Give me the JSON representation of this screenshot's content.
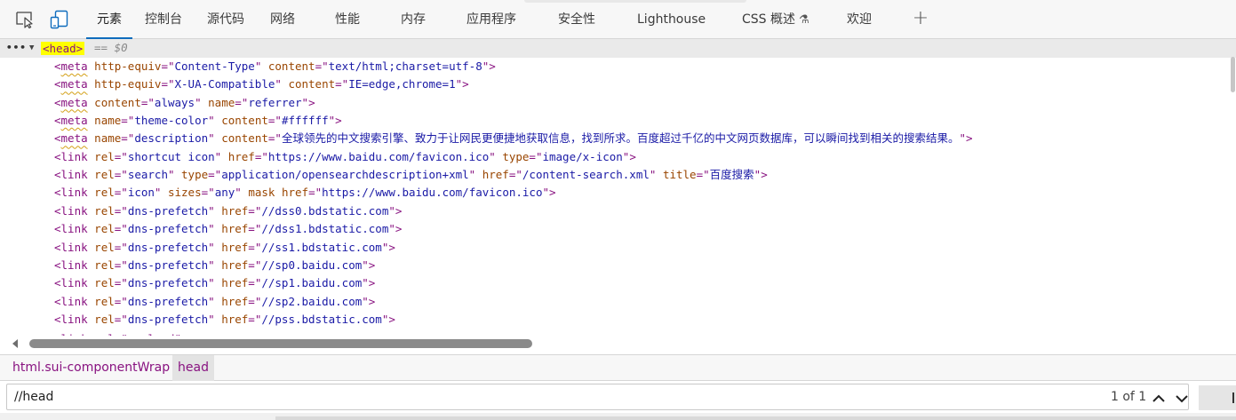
{
  "tabs": [
    {
      "label": "元素",
      "active": true
    },
    {
      "label": "控制台"
    },
    {
      "label": "源代码"
    },
    {
      "label": "网络"
    },
    {
      "label": "性能"
    },
    {
      "label": "内存"
    },
    {
      "label": "应用程序"
    },
    {
      "label": "安全性"
    },
    {
      "label": "Lighthouse"
    },
    {
      "label": "CSS 概述"
    },
    {
      "label": "欢迎"
    }
  ],
  "add_tab_label": "+",
  "dom": {
    "dots": "•••",
    "head_tag": "<head>",
    "selected_marker": "== $0",
    "lines": [
      {
        "tag": "meta",
        "attrs": [
          [
            "http-equiv",
            "Content-Type"
          ],
          [
            "content",
            "text/html;charset=utf-8"
          ]
        ]
      },
      {
        "tag": "meta",
        "attrs": [
          [
            "http-equiv",
            "X-UA-Compatible"
          ],
          [
            "content",
            "IE=edge,chrome=1"
          ]
        ]
      },
      {
        "tag": "meta",
        "attrs": [
          [
            "content",
            "always"
          ],
          [
            "name",
            "referrer"
          ]
        ]
      },
      {
        "tag": "meta",
        "attrs": [
          [
            "name",
            "theme-color"
          ],
          [
            "content",
            "#ffffff"
          ]
        ]
      },
      {
        "tag": "meta",
        "attrs": [
          [
            "name",
            "description"
          ],
          [
            "content",
            "全球领先的中文搜索引擎、致力于让网民更便捷地获取信息，找到所求。百度超过千亿的中文网页数据库，可以瞬间找到相关的搜索结果。"
          ]
        ]
      },
      {
        "tag": "link",
        "attrs": [
          [
            "rel",
            "shortcut icon"
          ],
          [
            "href",
            "https://www.baidu.com/favicon.ico"
          ],
          [
            "type",
            "image/x-icon"
          ]
        ]
      },
      {
        "tag": "link",
        "attrs": [
          [
            "rel",
            "search"
          ],
          [
            "type",
            "application/opensearchdescription+xml"
          ],
          [
            "href",
            "/content-search.xml"
          ],
          [
            "title",
            "百度搜索"
          ]
        ]
      },
      {
        "tag": "link",
        "attrs": [
          [
            "rel",
            "icon"
          ],
          [
            "sizes",
            "any"
          ],
          [
            "mask",
            null
          ],
          [
            "href",
            "https://www.baidu.com/favicon.ico"
          ]
        ]
      },
      {
        "tag": "link",
        "attrs": [
          [
            "rel",
            "dns-prefetch"
          ],
          [
            "href",
            "//dss0.bdstatic.com"
          ]
        ]
      },
      {
        "tag": "link",
        "attrs": [
          [
            "rel",
            "dns-prefetch"
          ],
          [
            "href",
            "//dss1.bdstatic.com"
          ]
        ]
      },
      {
        "tag": "link",
        "attrs": [
          [
            "rel",
            "dns-prefetch"
          ],
          [
            "href",
            "//ss1.bdstatic.com"
          ]
        ]
      },
      {
        "tag": "link",
        "attrs": [
          [
            "rel",
            "dns-prefetch"
          ],
          [
            "href",
            "//sp0.baidu.com"
          ]
        ]
      },
      {
        "tag": "link",
        "attrs": [
          [
            "rel",
            "dns-prefetch"
          ],
          [
            "href",
            "//sp1.baidu.com"
          ]
        ]
      },
      {
        "tag": "link",
        "attrs": [
          [
            "rel",
            "dns-prefetch"
          ],
          [
            "href",
            "//sp2.baidu.com"
          ]
        ]
      },
      {
        "tag": "link",
        "attrs": [
          [
            "rel",
            "dns-prefetch"
          ],
          [
            "href",
            "//pss.bdstatic.com"
          ]
        ]
      }
    ]
  },
  "breadcrumb": {
    "items": [
      "html.sui-componentWrap",
      "head"
    ]
  },
  "search": {
    "value": "//head",
    "match_count": "1 of 1"
  },
  "icons": {
    "inspect": "inspect-element-icon",
    "device": "device-toolbar-icon",
    "flask": "experiment-flask-icon",
    "up": "chevron-up-icon",
    "down": "chevron-down-icon"
  },
  "colors": {
    "tag": "#881280",
    "attr_name": "#994500",
    "attr_value": "#1a1aa6",
    "accent": "#0f6cbd",
    "highlight": "#ffff00"
  }
}
